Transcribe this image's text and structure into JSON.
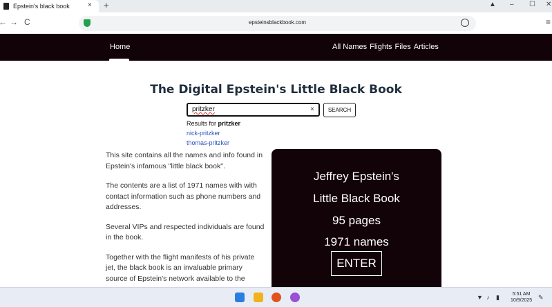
{
  "browser": {
    "tab_title": "Epstein's black book",
    "tab_close": "×",
    "new_tab": "+",
    "url": "epsteinsblackbook.com",
    "nav_back": "←",
    "nav_forward": "→",
    "nav_reload": "C",
    "menu": "≡",
    "win_minimize": "–",
    "win_maximize": "☐",
    "win_close": "✕"
  },
  "site_nav": {
    "home": "Home",
    "links": [
      "All Names",
      "Flights",
      "Files",
      "Articles"
    ]
  },
  "heading": "The Digital Epstein's Little Black Book",
  "search": {
    "value": "pritzker",
    "clear": "×",
    "button": "SEARCH"
  },
  "results": {
    "prefix": "Results for",
    "query": "pritzker",
    "items": [
      "nick-pritzker",
      "thomas-pritzker"
    ]
  },
  "body_paragraphs": [
    "This site contains all the names and info found in Epstein's infamous \"little black book\".",
    "The contents are a list of 1971 names with with contact information such as phone numbers and addresses.",
    "Several VIPs and respected individuals are found in the book.",
    "Together with the flight manifests of his private jet, the black book is an invaluable primary source of Epstein's network available to the"
  ],
  "card": {
    "line1": "Jeffrey Epstein's",
    "line2": "Little Black Book",
    "line3": "95 pages",
    "line4": "1971 names",
    "enter": "ENTER"
  },
  "taskbar": {
    "time": "5:51 AM",
    "date": "10/9/2025"
  }
}
